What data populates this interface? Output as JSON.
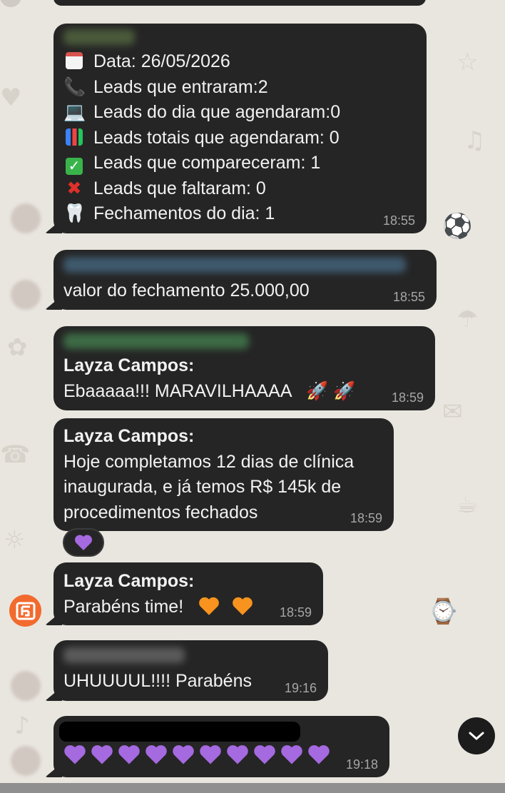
{
  "messages": {
    "report": {
      "lines": [
        {
          "icon": "calendar",
          "text": "Data: 26/05/2026"
        },
        {
          "icon": "telephone-receiver",
          "text": "Leads que entraram:2"
        },
        {
          "icon": "laptop",
          "text": "Leads do dia que agendaram:0"
        },
        {
          "icon": "bar-chart",
          "text": "Leads totais que agendaram: 0"
        },
        {
          "icon": "check-mark-button",
          "text": "Leads que compareceram: 1"
        },
        {
          "icon": "cross-mark",
          "text": "Leads que faltaram: 0"
        },
        {
          "icon": "tooth",
          "text": "Fechamentos do dia: 1"
        }
      ],
      "time": "18:55"
    },
    "fechamento": {
      "text": "valor do fechamento 25.000,00",
      "time": "18:55"
    },
    "ebaaaa": {
      "sender": "Layza Campos:",
      "text": "Ebaaaaa!!! MARAVILHAAAA",
      "time": "18:59"
    },
    "clinica": {
      "sender": "Layza Campos:",
      "lines": [
        "Hoje completamos 12 dias de clínica",
        "inaugurada, e já temos R$ 145k de",
        "procedimentos fechados"
      ],
      "time": "18:59",
      "reaction": "purple-heart"
    },
    "parabens": {
      "sender": "Layza Campos:",
      "text": "Parabéns time!",
      "time": "18:59"
    },
    "uhuuuul": {
      "text": "UHUUUUL!!!! Parabéns",
      "time": "19:16"
    },
    "hearts": {
      "icon": "purple-heart",
      "count": 10,
      "time": "19:18"
    }
  },
  "colors": {
    "bubble": "#252525",
    "purple_heart": "#a569e0",
    "orange_heart": "#f7931e",
    "brand_avatar": "#f26a2e"
  }
}
